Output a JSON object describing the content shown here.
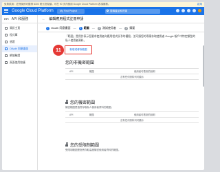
{
  "notice": {
    "text": "免費試用：註冊後即可獲得 $300 美元抵免額，可在 90 天內使用 Google Cloud Platform 各項服務。",
    "action": "啟用"
  },
  "topbar": {
    "brand": "Google Cloud Platform",
    "project": "My First Project",
    "search_placeholder": "搜尋產品和資源"
  },
  "sidebar": {
    "title": "API 和服務",
    "items": [
      {
        "label": "資訊主頁"
      },
      {
        "label": "程式庫"
      },
      {
        "label": "憑證"
      },
      {
        "label": "OAuth 同意畫面"
      },
      {
        "label": "網域驗證"
      },
      {
        "label": "頁面使用協議"
      }
    ]
  },
  "page": {
    "title": "編輯應用程式註冊申請"
  },
  "steps": [
    {
      "num": "1",
      "label": "OAuth 同意畫面"
    },
    {
      "num": "2",
      "label": "範圍"
    },
    {
      "num": "3",
      "label": "測試使用者"
    },
    {
      "num": "4",
      "label": "摘要"
    }
  ],
  "scopes_intro": "「範圍」是用於表示您要求使用者向應用程式授予的權限，並可讓您的專案存取使用者 Google 帳戶中特定類型的私人使用者資料。",
  "add_button": "新增或移除範圍",
  "step_badge": "11",
  "sections": [
    {
      "title": "您的非機密範圍",
      "table": {
        "c1": "API",
        "c2": "範圍",
        "c3": "使用者可看到的說明"
      },
      "empty": "沒有任何資料列可顯示"
    },
    {
      "title": "您的機密範圍",
      "subtitle": "機密範圍是指會存取私人使用者資料的範圍。",
      "table": {
        "c1": "API",
        "c2": "範圍",
        "c3": "使用者可看到的說明"
      },
      "empty": "沒有任何資料列可顯示"
    },
    {
      "title": "您的受限制範圍",
      "subtitle": "受限制範圍是指會存取高度機密使用者資料的範圍。"
    }
  ]
}
